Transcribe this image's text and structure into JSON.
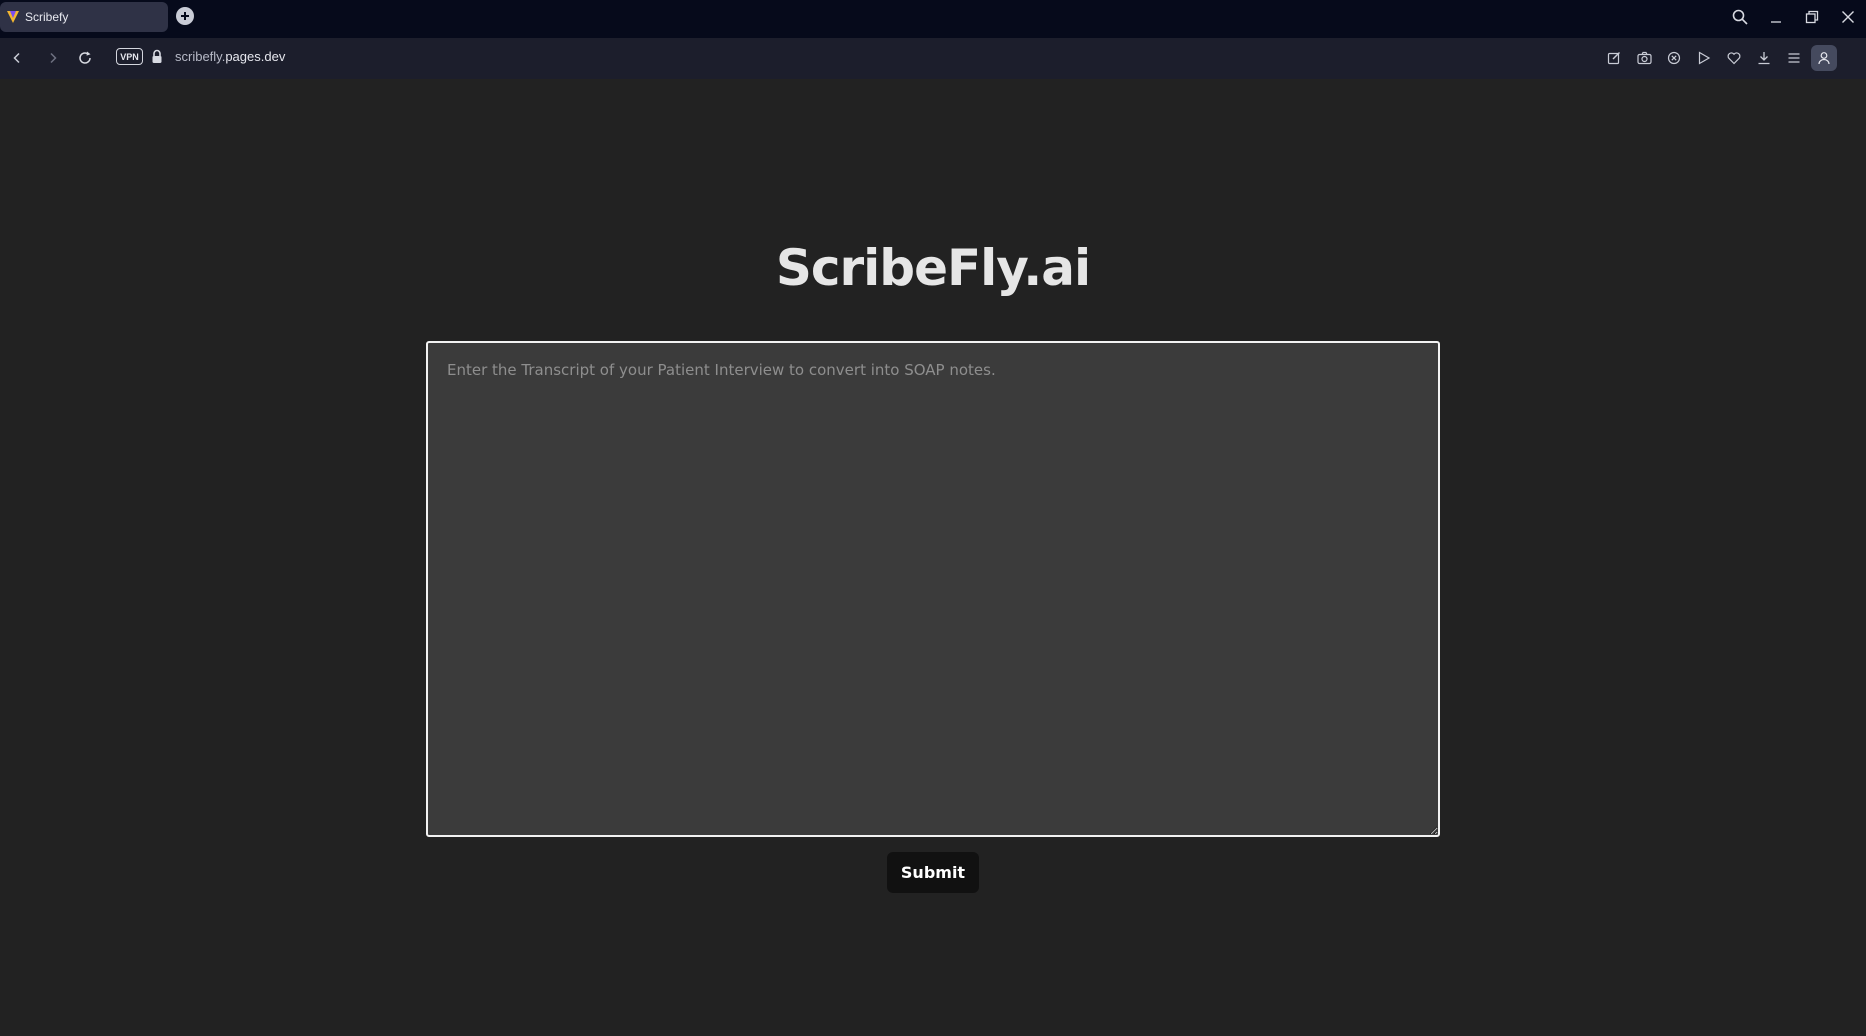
{
  "browser": {
    "tab_title": "Scribefy",
    "vpn_label": "VPN",
    "url_host_prefix": "scribefly.",
    "url_host_main": "pages.dev"
  },
  "page": {
    "title": "ScribeFly.ai",
    "transcript_placeholder": "Enter the Transcript of your Patient Interview to convert into SOAP notes.",
    "transcript_value": "",
    "submit_label": "Submit"
  },
  "icons": {
    "favicon": "scribefy-logo-icon",
    "new_tab": "plus-icon",
    "search": "search-icon",
    "minimize": "minimize-icon",
    "restore": "restore-icon",
    "close": "close-icon",
    "back": "chevron-left-icon",
    "forward": "chevron-right-icon",
    "reload": "reload-icon",
    "lock": "lock-icon",
    "edit": "edit-icon",
    "snapshot": "camera-icon",
    "adblock": "shield-x-icon",
    "flow": "send-icon",
    "pinboard": "heart-icon",
    "download": "download-icon",
    "easy_setup": "menu-icon",
    "profile": "person-icon"
  },
  "colors": {
    "page_background": "#222222",
    "textarea_background": "#3b3b3b",
    "button_background": "#111111",
    "accent": "#5a3cf0"
  }
}
